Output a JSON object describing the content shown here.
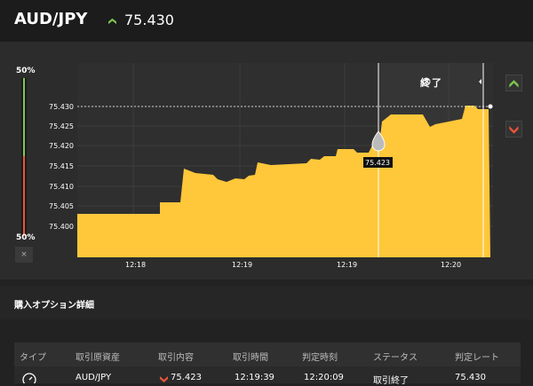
{
  "header": {
    "pair": "AUD/JPY",
    "price": "75.430",
    "up_color": "#7ec850"
  },
  "sidebar": {
    "top_pct": "50%",
    "bottom_pct": "50%",
    "close_symbol": "×"
  },
  "chart": {
    "current_label": "終了",
    "marker_value": "75.423",
    "y_ticks": [
      "75.430",
      "75.425",
      "75.420",
      "75.415",
      "75.410",
      "75.405",
      "75.400"
    ],
    "x_ticks": [
      "12:18",
      "12:19",
      "12:19",
      "12:20"
    ],
    "area_color": "#ffc73a",
    "up_button_color": "#7ec850",
    "down_button_color": "#e8553a"
  },
  "details": {
    "title": "購入オプション詳細",
    "columns": [
      "タイプ",
      "取引原資産",
      "取引内容",
      "取引時間",
      "判定時刻",
      "ステータス",
      "判定レート"
    ],
    "row": {
      "asset": "AUD/JPY",
      "content": "75.423",
      "trade_time": "12:19:39",
      "judge_time": "12:20:09",
      "status": "取引終了",
      "rate": "75.430"
    }
  }
}
